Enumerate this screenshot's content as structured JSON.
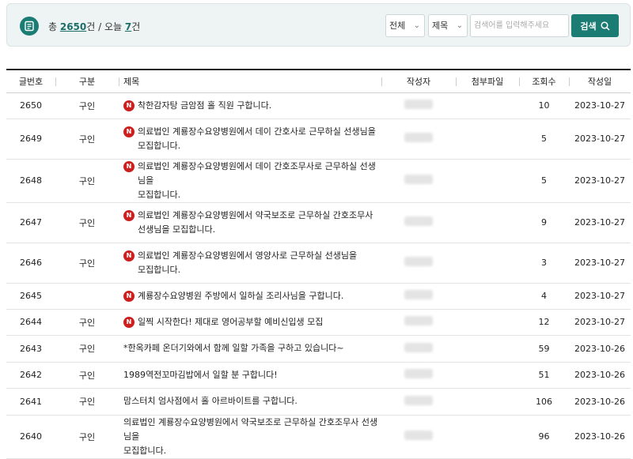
{
  "summary": {
    "total_prefix": "총 ",
    "total_count": "2650",
    "total_suffix": "건 / 오늘 ",
    "today_count": "7",
    "today_suffix": "건"
  },
  "search": {
    "scope_selected": "전체",
    "field_selected": "제목",
    "placeholder": "검색어를 입력해주세요",
    "button_label": "검색"
  },
  "table": {
    "headers": [
      "글번호",
      "구분",
      "제목",
      "작성자",
      "첨부파일",
      "조회수",
      "작성일"
    ],
    "new_badge": "N",
    "rows": [
      {
        "no": "2650",
        "category": "구인",
        "is_new": true,
        "title_l1": "착한감자탕 금암점 홀 직원 구합니다.",
        "title_l2": "",
        "views": "10",
        "date": "2023-10-27"
      },
      {
        "no": "2649",
        "category": "구인",
        "is_new": true,
        "title_l1": "의료법인 계룡장수요양병원에서 데이 간호사로 근무하실 선생님을",
        "title_l2": "모집합니다.",
        "views": "5",
        "date": "2023-10-27"
      },
      {
        "no": "2648",
        "category": "구인",
        "is_new": true,
        "title_l1": "의료법인 계룡장수요양병원에서 데이 간호조무사로 근무하실 선생님을",
        "title_l2": "모집합니다.",
        "views": "5",
        "date": "2023-10-27"
      },
      {
        "no": "2647",
        "category": "구인",
        "is_new": true,
        "title_l1": "의료법인 계룡장수요양병원에서 약국보조로 근무하실 간호조무사",
        "title_l2": "선생님을 모집합니다.",
        "views": "9",
        "date": "2023-10-27"
      },
      {
        "no": "2646",
        "category": "구인",
        "is_new": true,
        "title_l1": "의료법인 계룡장수요양병원에서 영양사로 근무하실 선생님을",
        "title_l2": "모집합니다.",
        "views": "3",
        "date": "2023-10-27"
      },
      {
        "no": "2645",
        "category": "",
        "is_new": true,
        "title_l1": "계룡장수요양병원 주방에서 일하실 조리사님을 구합니다.",
        "title_l2": "",
        "views": "4",
        "date": "2023-10-27"
      },
      {
        "no": "2644",
        "category": "구인",
        "is_new": true,
        "title_l1": "일찍 시작한다! 제대로 영어공부할 예비신입생 모집",
        "title_l2": "",
        "views": "12",
        "date": "2023-10-27"
      },
      {
        "no": "2643",
        "category": "구인",
        "is_new": false,
        "title_l1": "*한옥카페 온더기와에서 함께 일할 가족을 구하고 있습니다~",
        "title_l2": "",
        "views": "59",
        "date": "2023-10-26"
      },
      {
        "no": "2642",
        "category": "구인",
        "is_new": false,
        "title_l1": "1989역전꼬마김밥에서 일할 분 구합니다!",
        "title_l2": "",
        "views": "51",
        "date": "2023-10-26"
      },
      {
        "no": "2641",
        "category": "구인",
        "is_new": false,
        "title_l1": "맘스터치 엄사점에서 홀 아르바이트를 구합니다.",
        "title_l2": "",
        "views": "106",
        "date": "2023-10-26"
      },
      {
        "no": "2640",
        "category": "구인",
        "is_new": false,
        "title_l1": "의료법인 계룡장수요양병원에서 약국보조로 근무하실 간호조무사 선생님을",
        "title_l2": "모집합니다.",
        "views": "96",
        "date": "2023-10-26"
      }
    ]
  },
  "colors": {
    "accent": "#1a7c73",
    "new_badge": "#cc1f1f",
    "topbar_bg": "#eef3f4"
  },
  "icons": {
    "summary": "document-list-icon",
    "search": "search-icon",
    "dropdown": "chevron-down-icon"
  }
}
